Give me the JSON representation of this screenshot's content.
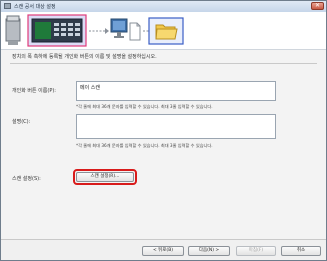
{
  "window": {
    "title": "스캔 공서 대상 설정",
    "close_glyph": "✕"
  },
  "header": {
    "description": "장치의 폭 측하에 등록될 개인화 버튼의 이름 및 설명을 설정하십시오."
  },
  "form": {
    "name": {
      "label": "개인화 버튼 이름(P):",
      "value": "메이 스캔",
      "note": "*각 줄에 최대 36개 문자를 입력할 수 있습니다. 최대 3줄 입력할 수 있습니다."
    },
    "description": {
      "label": "설명(C):",
      "value": "",
      "note": "*각 줄에 최대 36개 문자를 입력할 수 있습니다. 최대 3줄 입력할 수 있습니다."
    },
    "scan_settings": {
      "label": "스캔 설정(S):",
      "button_label": "스캔 설정(R)..."
    }
  },
  "footer": {
    "back_label": "< 뒤로(B)",
    "next_label": "다음(N) >",
    "finish_label": "마침(F)",
    "cancel_label": "취소"
  },
  "colors": {
    "highlight": "#d81b1b",
    "accent": "#2f6fc4"
  }
}
